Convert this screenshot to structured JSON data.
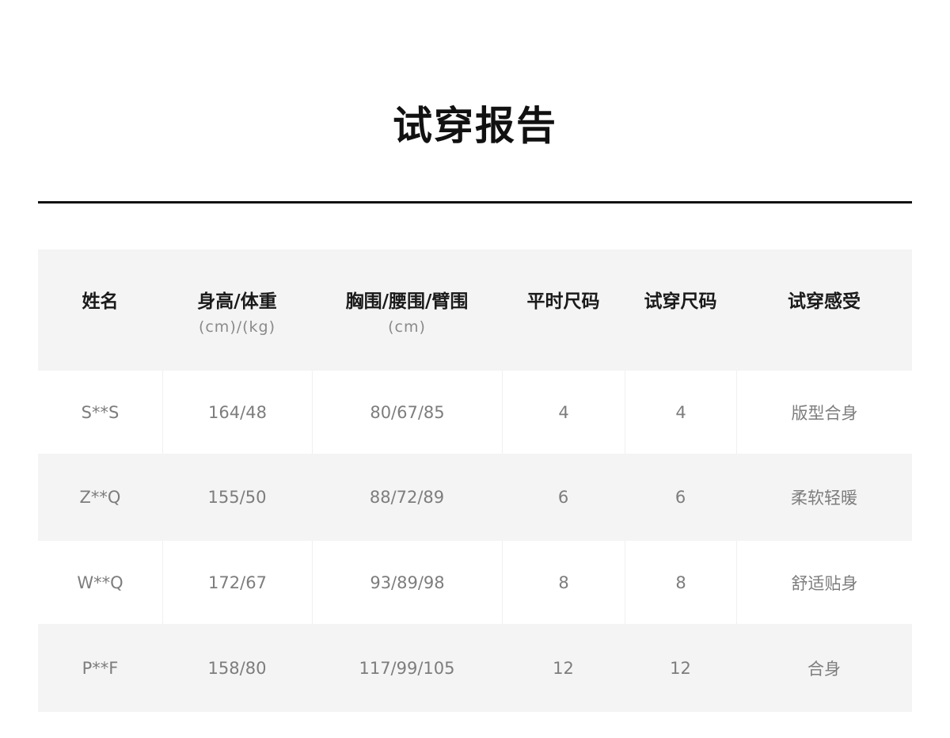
{
  "title": "试穿报告",
  "table": {
    "headers": [
      {
        "main": "姓名",
        "sub": ""
      },
      {
        "main": "身高/体重",
        "sub": "(cm)/(kg)"
      },
      {
        "main": "胸围/腰围/臂围",
        "sub": "(cm)"
      },
      {
        "main": "平时尺码",
        "sub": ""
      },
      {
        "main": "试穿尺码",
        "sub": ""
      },
      {
        "main": "试穿感受",
        "sub": ""
      }
    ],
    "rows": [
      [
        "S**S",
        "164/48",
        "80/67/85",
        "4",
        "4",
        "版型合身"
      ],
      [
        "Z**Q",
        "155/50",
        "88/72/89",
        "6",
        "6",
        "柔软轻暖"
      ],
      [
        "W**Q",
        "172/67",
        "93/89/98",
        "8",
        "8",
        "舒适贴身"
      ],
      [
        "P**F",
        "158/80",
        "117/99/105",
        "12",
        "12",
        "合身"
      ]
    ]
  }
}
